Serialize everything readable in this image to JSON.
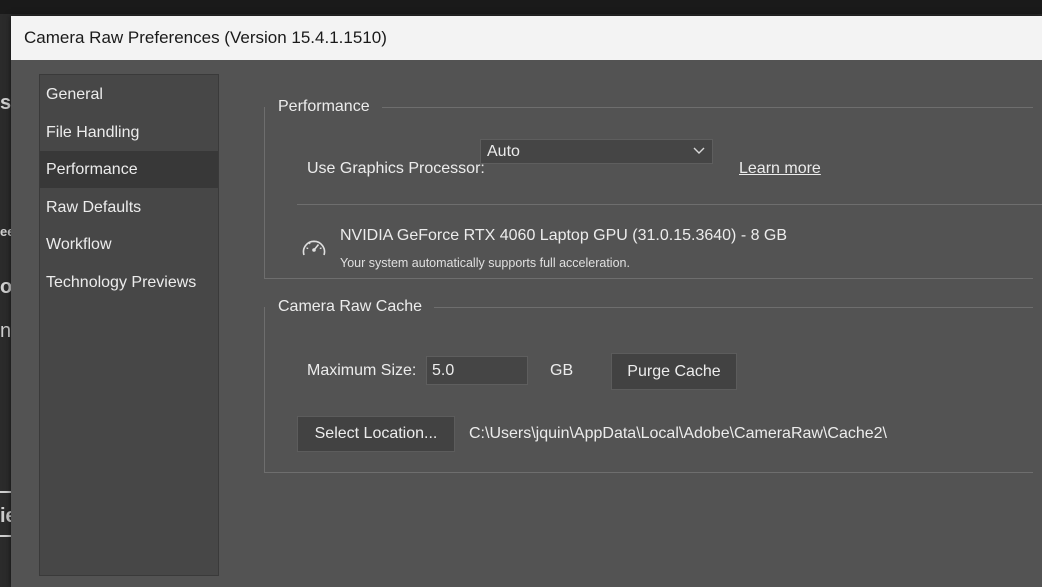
{
  "window": {
    "title": "Camera Raw Preferences  (Version 15.4.1.1510)"
  },
  "sidebar": {
    "items": [
      {
        "label": "General"
      },
      {
        "label": "File Handling"
      },
      {
        "label": "Performance",
        "selected": true
      },
      {
        "label": "Raw Defaults"
      },
      {
        "label": "Workflow"
      },
      {
        "label": "Technology Previews"
      }
    ]
  },
  "performance": {
    "legend": "Performance",
    "gpu_label": "Use Graphics Processor:",
    "gpu_select_value": "Auto",
    "learn_more": "Learn more",
    "gpu_name": "NVIDIA GeForce RTX 4060 Laptop GPU (31.0.15.3640) - 8 GB",
    "gpu_status": "Your system automatically supports full acceleration.",
    "gauge_icon": "gauge-icon"
  },
  "cache": {
    "legend": "Camera Raw Cache",
    "max_size_label": "Maximum Size:",
    "max_size_value": "5.0",
    "unit": "GB",
    "purge_button": "Purge Cache",
    "select_location_button": "Select Location...",
    "path": "C:\\Users\\jquin\\AppData\\Local\\Adobe\\CameraRaw\\Cache2\\"
  },
  "background_fragments": [
    "st",
    "ee",
    "oc",
    "n",
    "ie"
  ],
  "colors": {
    "dialog_bg": "#535353",
    "sidebar_bg": "#474747",
    "selected_bg": "#383838",
    "titlebar_bg": "#f3f3f3"
  }
}
